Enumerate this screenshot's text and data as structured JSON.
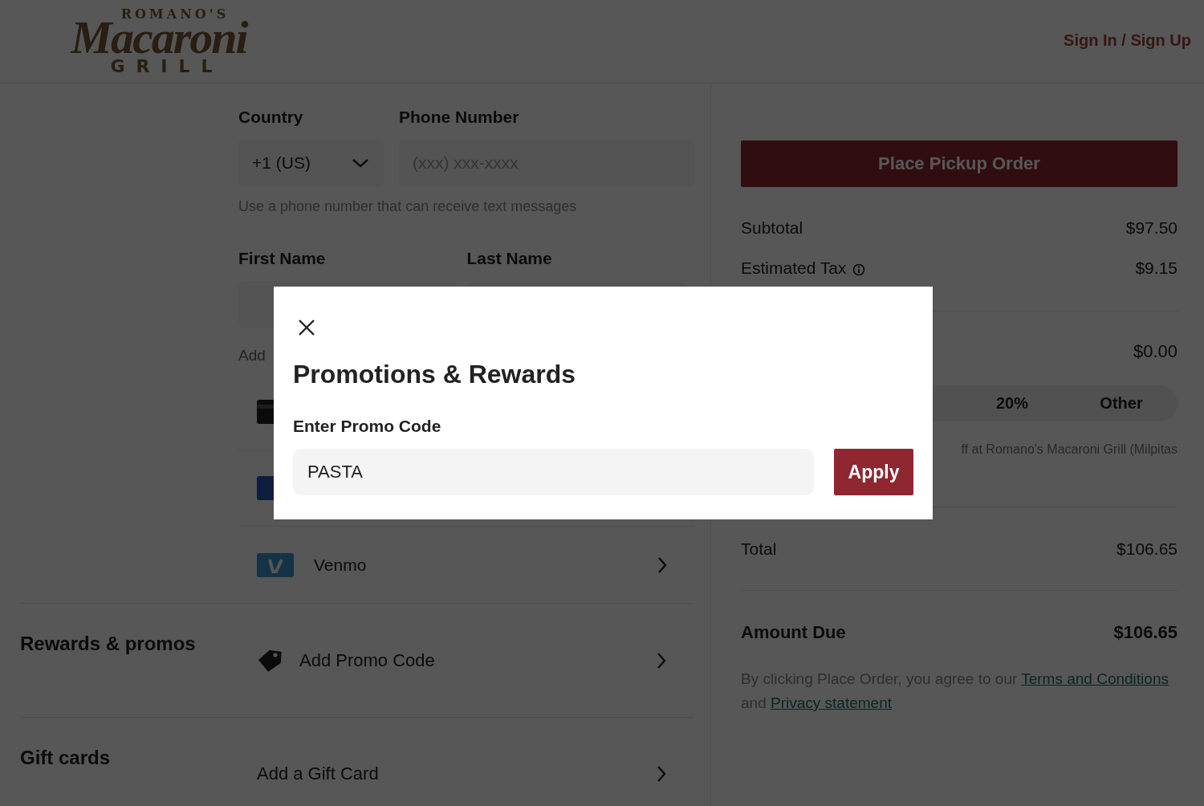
{
  "header": {
    "logo": {
      "top": "ROMANO'S",
      "main": "Macaroni",
      "bottom": "GRILL"
    },
    "sign_in": "Sign In / Sign Up"
  },
  "contact_form": {
    "country": {
      "label": "Country",
      "value": "+1 (US)"
    },
    "phone": {
      "label": "Phone Number",
      "placeholder": "(xxx) xxx-xxxx",
      "hint": "Use a phone number that can receive text messages"
    },
    "first_name": {
      "label": "First Name"
    },
    "last_name": {
      "label": "Last Name"
    }
  },
  "payment": {
    "heading": "Add",
    "methods": [
      {
        "kind": "card"
      },
      {
        "kind": "blue_card"
      },
      {
        "kind": "venmo",
        "label": "Venmo"
      }
    ]
  },
  "sections": [
    {
      "title": "Rewards & promos",
      "action": "Add Promo Code",
      "kind": "promo"
    },
    {
      "title": "Gift cards",
      "action": "Add a Gift Card",
      "kind": "gift"
    }
  ],
  "summary": {
    "button": "Place Pickup Order",
    "lines": [
      {
        "label": "Subtotal",
        "value": "$97.50",
        "info": false
      },
      {
        "label": "Estimated Tax",
        "value": "$9.15",
        "info": true
      }
    ],
    "tip_amount": "$0.00",
    "tip_options": [
      {
        "label": "20%"
      },
      {
        "label": "Other"
      }
    ],
    "tip_note": "ff at Romano's Macaroni Grill (Milpitas",
    "total": {
      "label": "Total",
      "value": "$106.65"
    },
    "amount_due": {
      "label": "Amount Due",
      "value": "$106.65"
    },
    "terms": {
      "text": "By clicking Place Order, you agree to our ",
      "link1": "Terms and Conditions",
      "middle": " and ",
      "link2": "Privacy statement"
    }
  },
  "modal": {
    "title": "Promotions & Rewards",
    "field_label": "Enter Promo Code",
    "value": "PASTA",
    "button": "Apply"
  }
}
